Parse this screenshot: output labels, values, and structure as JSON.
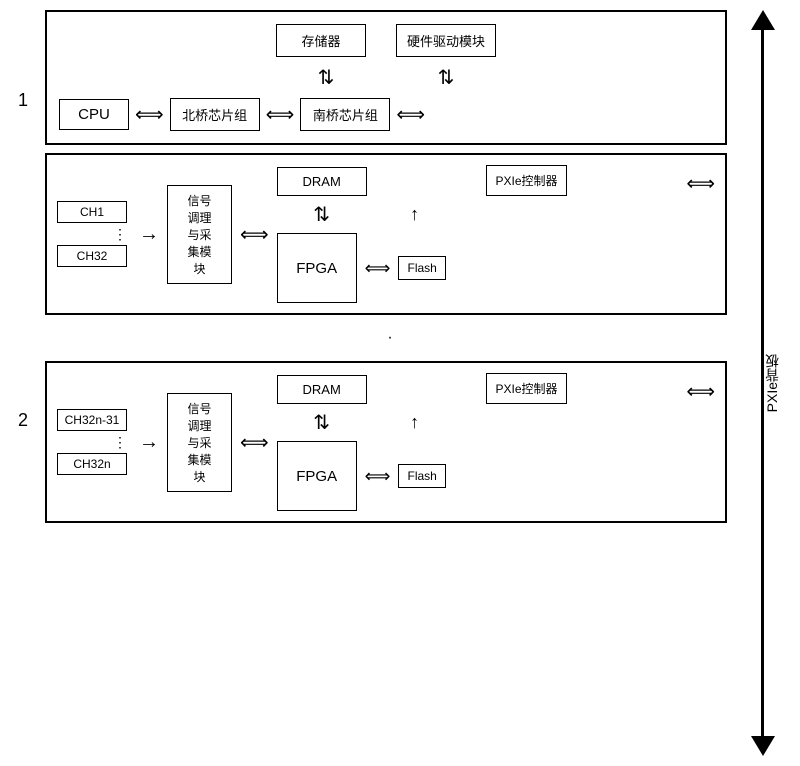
{
  "labels": {
    "label1": "1",
    "label2": "2",
    "pxie_backplane": "PXIe背板"
  },
  "section1": {
    "memory": "存储器",
    "hardware_driver": "硬件驱动模块",
    "cpu": "CPU",
    "north_bridge": "北桥芯片组",
    "south_bridge": "南桥芯片组"
  },
  "section2": {
    "ch1": "CH1",
    "ch32": "CH32",
    "signal_module": "信号\n调理\n与采\n集模\n块",
    "dram": "DRAM",
    "fpga": "FPGA",
    "pxie_controller": "PXIe控制器",
    "flash": "Flash"
  },
  "section3": {
    "ch_start": "CH32n-31",
    "ch_end": "CH32n",
    "signal_module": "信号\n调理\n与采\n集模\n块",
    "dram": "DRAM",
    "fpga": "FPGA",
    "pxie_controller": "PXIe控制器",
    "flash": "Flash"
  },
  "arrows": {
    "double_h": "⟺",
    "double_v_up": "⇅",
    "right": "→",
    "up": "↑"
  }
}
